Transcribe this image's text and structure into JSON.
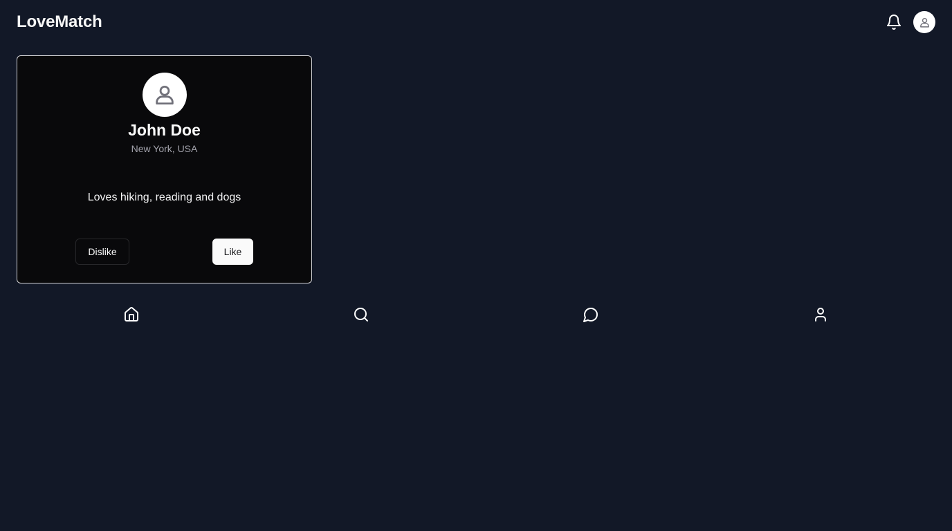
{
  "header": {
    "app_title": "LoveMatch",
    "icons": [
      "bell-icon",
      "user-icon"
    ]
  },
  "profile_card": {
    "name": "John Doe",
    "location": "New York, USA",
    "bio": "Loves hiking, reading and dogs",
    "avatar_icon": "user-icon",
    "dislike_label": "Dislike",
    "like_label": "Like"
  },
  "bottom_nav": {
    "items": [
      {
        "icon": "home-icon"
      },
      {
        "icon": "search-icon"
      },
      {
        "icon": "message-circle-icon"
      },
      {
        "icon": "user-icon"
      }
    ]
  },
  "colors": {
    "background": "#121827",
    "card_background": "#09090b",
    "card_border": "#d4d4d8",
    "text_primary": "#fafafa",
    "text_muted": "#a1a1aa",
    "like_button_bg": "#fafafa"
  }
}
